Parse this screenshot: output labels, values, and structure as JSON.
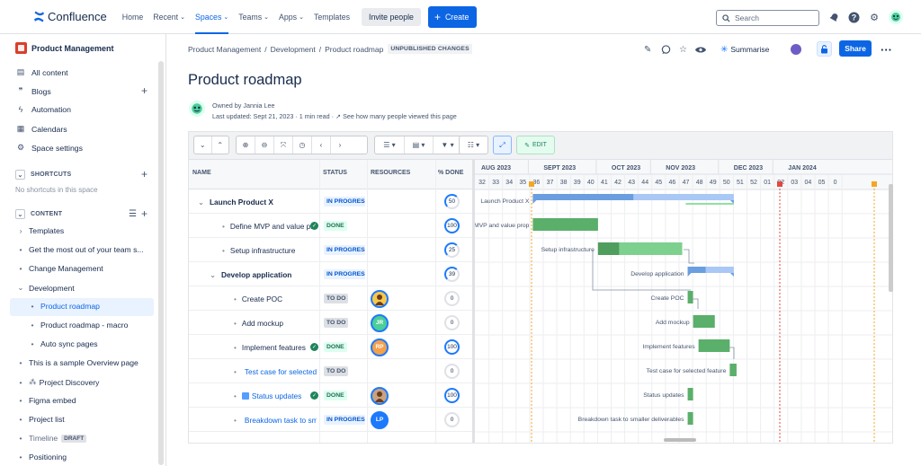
{
  "topbar": {
    "app_name": "Confluence",
    "nav": [
      {
        "label": "Home",
        "caret": false
      },
      {
        "label": "Recent",
        "caret": true
      },
      {
        "label": "Spaces",
        "caret": true,
        "active": true
      },
      {
        "label": "Teams",
        "caret": true
      },
      {
        "label": "Apps",
        "caret": true
      },
      {
        "label": "Templates",
        "caret": false
      }
    ],
    "invite_label": "Invite people",
    "create_label": "Create",
    "search_placeholder": "Search"
  },
  "sidebar": {
    "space_name": "Product Management",
    "items": [
      {
        "label": "All content",
        "icon": "list-icon"
      },
      {
        "label": "Blogs",
        "icon": "quote-icon"
      },
      {
        "label": "Automation",
        "icon": "bolt-icon"
      },
      {
        "label": "Calendars",
        "icon": "calendar-icon"
      },
      {
        "label": "Space settings",
        "icon": "gear-icon"
      }
    ],
    "shortcuts_label": "SHORTCUTS",
    "no_shortcuts": "No shortcuts in this space",
    "content_label": "CONTENT",
    "tree": [
      {
        "label": "Templates",
        "bullet": "›",
        "indent": 0
      },
      {
        "label": "Get the most out of your team s...",
        "bullet": "•",
        "indent": 0
      },
      {
        "label": "Change Management",
        "bullet": "•",
        "indent": 0
      },
      {
        "label": "Development",
        "bullet": "⌄",
        "indent": 0
      },
      {
        "label": "Product roadmap",
        "bullet": "•",
        "indent": 1,
        "selected": true
      },
      {
        "label": "Product roadmap - macro",
        "bullet": "•",
        "indent": 1
      },
      {
        "label": "Auto sync pages",
        "bullet": "•",
        "indent": 1
      },
      {
        "label": "This is a sample Overview page",
        "bullet": "•",
        "indent": 0
      },
      {
        "label": "Project Discovery",
        "bullet": "•",
        "indent": 0
      },
      {
        "label": "Figma embed",
        "bullet": "•",
        "indent": 0
      },
      {
        "label": "Project list",
        "bullet": "•",
        "indent": 0
      },
      {
        "label": "Timeline",
        "bullet": "•",
        "indent": 0,
        "badge": "DRAFT"
      },
      {
        "label": "Positioning",
        "bullet": "•",
        "indent": 0
      }
    ]
  },
  "page": {
    "breadcrumb": [
      "Product Management",
      "Development",
      "Product roadmap"
    ],
    "unpublished": "UNPUBLISHED CHANGES",
    "title": "Product roadmap",
    "owner": "Owned by Jannia Lee",
    "updated": "Last updated: Sept 21, 2023",
    "read_time": "1 min read",
    "views_link": "See how many people viewed this page",
    "summarise_label": "Summarise",
    "share_label": "Share"
  },
  "gantt": {
    "edit_label": "EDIT",
    "columns": [
      "NAME",
      "STATUS",
      "RESOURCES",
      "% DONE"
    ],
    "months": [
      "AUG 2023",
      "SEPT 2023",
      "OCT 2023",
      "NOV 2023",
      "DEC 2023",
      "JAN 2024"
    ],
    "weeks": [
      "32",
      "33",
      "34",
      "35",
      "36",
      "37",
      "38",
      "39",
      "40",
      "41",
      "42",
      "43",
      "44",
      "45",
      "46",
      "47",
      "48",
      "49",
      "50",
      "51",
      "52",
      "01",
      "02",
      "03",
      "04",
      "05",
      "0"
    ],
    "rows": [
      {
        "name": "Launch Product X",
        "bold": true,
        "toggle": "⌄",
        "status": "IN PROGRESS",
        "status_type": "ip",
        "resource": "",
        "done": "50",
        "bar_label": "Launch Product X"
      },
      {
        "name": "Define MVP and value prop",
        "done_check": true,
        "status": "DONE",
        "status_type": "dn",
        "resource": "",
        "done": "100",
        "bar_label": "Define MVP and value prop"
      },
      {
        "name": "Setup infrastructure",
        "status": "IN PROGRESS",
        "status_type": "ip",
        "resource": "",
        "done": "25",
        "bar_label": "Setup infrastructure"
      },
      {
        "name": "Develop application",
        "bold": true,
        "toggle": "⌄",
        "status": "IN PROGRESS",
        "status_type": "ip",
        "resource": "",
        "done": "39",
        "bar_label": "Develop application"
      },
      {
        "name": "Create POC",
        "status": "TO DO",
        "status_type": "td",
        "resource": "photo",
        "done": "0",
        "bar_label": "Create POC"
      },
      {
        "name": "Add mockup",
        "status": "TO DO",
        "status_type": "td",
        "resource": "JR",
        "done": "0",
        "bar_label": "Add mockup"
      },
      {
        "name": "Implement features",
        "done_check": true,
        "status": "DONE",
        "status_type": "dn",
        "resource": "RP",
        "done": "100",
        "bar_label": "Implement features"
      },
      {
        "name": "Test case for selected feature",
        "link": true,
        "status": "TO DO",
        "status_type": "td",
        "resource": "",
        "done": "0",
        "bar_label": "Test case for selected feature"
      },
      {
        "name": "Status updates",
        "link": true,
        "done_check": true,
        "status": "DONE",
        "status_type": "dn",
        "resource": "photo2",
        "done": "100",
        "bar_label": "Status updates"
      },
      {
        "name": "Breakdown task to smaller deliverables",
        "link": true,
        "status": "IN PROGRESS",
        "status_type": "ip",
        "resource": "LP",
        "done": "0",
        "bar_label": "Breakdown task to smaller deliverables"
      }
    ],
    "colors": {
      "done": "#5aaf6a",
      "progress": "#79a7e8",
      "summary": "#6a9ee0",
      "today": "#e2483d",
      "milestone": "#f5a623"
    }
  }
}
